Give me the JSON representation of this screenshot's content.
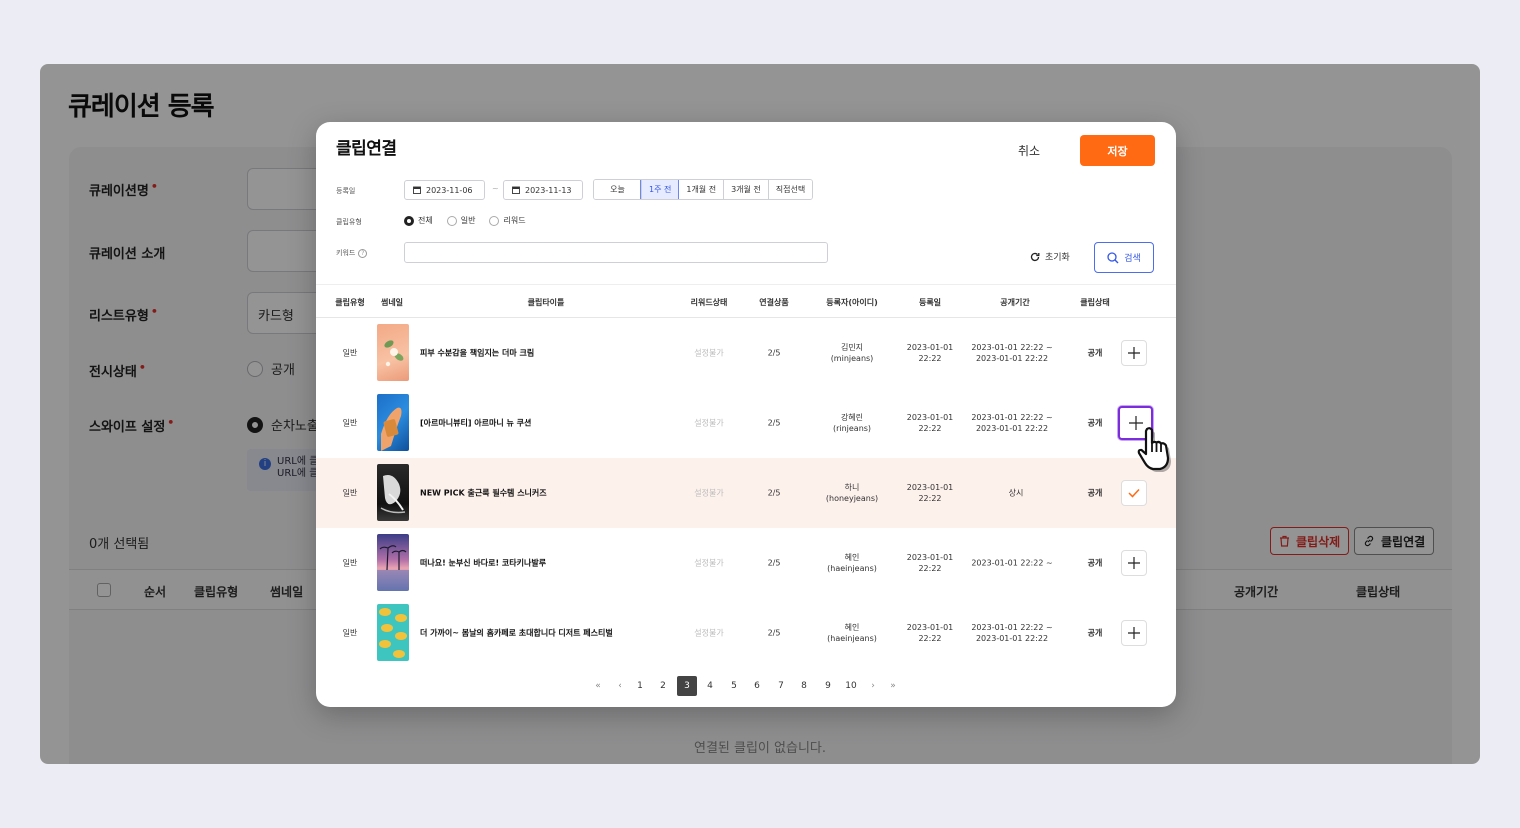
{
  "page": {
    "title": "큐레이션 등록",
    "fields": {
      "name_label": "큐레이션명",
      "intro_label": "큐레이션 소개",
      "list_type_label": "리스트유형",
      "list_type_value": "카드형",
      "display_label": "전시상태",
      "display_option": "공개",
      "swipe_label": "스와이프 설정",
      "swipe_option": "순차노출",
      "info_line1": "URL에 클",
      "info_line2": "URL에 클"
    },
    "selected_count": "0개 선택됨",
    "delete_button": "클립삭제",
    "link_button": "클립연결",
    "table_headers": {
      "order": "순서",
      "clip_type": "클립유형",
      "thumbnail": "썸네일",
      "period": "공개기간",
      "status": "클립상태"
    },
    "empty_text": "연결된 클립이 없습니다."
  },
  "modal": {
    "title": "클립연결",
    "cancel": "취소",
    "save": "저장",
    "filters": {
      "date_label": "등록일",
      "date_from": "2023-11-06",
      "date_sep": "~",
      "date_to": "2023-11-13",
      "ranges": [
        "오늘",
        "1주 전",
        "1개월 전",
        "3개월 전",
        "직접선택"
      ],
      "active_range": "1주 전",
      "type_label": "클립유형",
      "types": [
        "전체",
        "일반",
        "리워드"
      ],
      "keyword_label": "키워드",
      "keyword_value": "",
      "reset": "초기화",
      "search": "검색"
    },
    "columns": {
      "type": "클립유형",
      "thumb": "썸네일",
      "title": "클립타이틀",
      "reward": "리워드상태",
      "products": "연결상품",
      "author": "등록자(아이디)",
      "date": "등록일",
      "period": "공개기간",
      "status": "클립상태"
    },
    "rows": [
      {
        "type": "일반",
        "title": "피부 수분감을 책임지는 더마 크림",
        "reward": "설정불가",
        "products": "2/5",
        "author_name": "김민지",
        "author_id": "(minjeans)",
        "date": "2023-01-01",
        "time": "22:22",
        "period_from": "2023-01-01 22:22 ~",
        "period_to": "2023-01-01 22:22",
        "status": "공개",
        "action": "add"
      },
      {
        "type": "일반",
        "title": "[아르마니뷰티] 아르마니 뉴 쿠션",
        "reward": "설정불가",
        "products": "2/5",
        "author_name": "강혜린",
        "author_id": "(rinjeans)",
        "date": "2023-01-01",
        "time": "22:22",
        "period_from": "2023-01-01 22:22 ~",
        "period_to": "2023-01-01 22:22",
        "status": "공개",
        "action": "add"
      },
      {
        "type": "일반",
        "title": "NEW PICK 출근룩 필수템 스니커즈",
        "reward": "설정불가",
        "products": "2/5",
        "author_name": "하니",
        "author_id": "(honeyjeans)",
        "date": "2023-01-01",
        "time": "22:22",
        "period_from": "상시",
        "period_to": "",
        "status": "공개",
        "action": "added"
      },
      {
        "type": "일반",
        "title": "떠나요! 눈부신 바다로! 코타키나발루",
        "reward": "설정불가",
        "products": "2/5",
        "author_name": "혜인",
        "author_id": "(haeinjeans)",
        "date": "2023-01-01",
        "time": "22:22",
        "period_from": "2023-01-01 22:22 ~",
        "period_to": "",
        "status": "공개",
        "action": "add"
      },
      {
        "type": "일반",
        "title": "더 가까이~ 봄날의 홈카페로 초대합니다 디저트 페스티벌",
        "reward": "설정불가",
        "products": "2/5",
        "author_name": "혜인",
        "author_id": "(haeinjeans)",
        "date": "2023-01-01",
        "time": "22:22",
        "period_from": "2023-01-01 22:22 ~",
        "period_to": "2023-01-01 22:22",
        "status": "공개",
        "action": "add"
      }
    ],
    "pagination": {
      "pages": [
        "1",
        "2",
        "3",
        "4",
        "5",
        "6",
        "7",
        "8",
        "9",
        "10"
      ],
      "current": "3"
    }
  },
  "colors": {
    "accent_orange": "#ff6a13",
    "accent_blue": "#3457e8",
    "danger_red": "#e0312c",
    "focus_purple": "#7b2cdb"
  }
}
